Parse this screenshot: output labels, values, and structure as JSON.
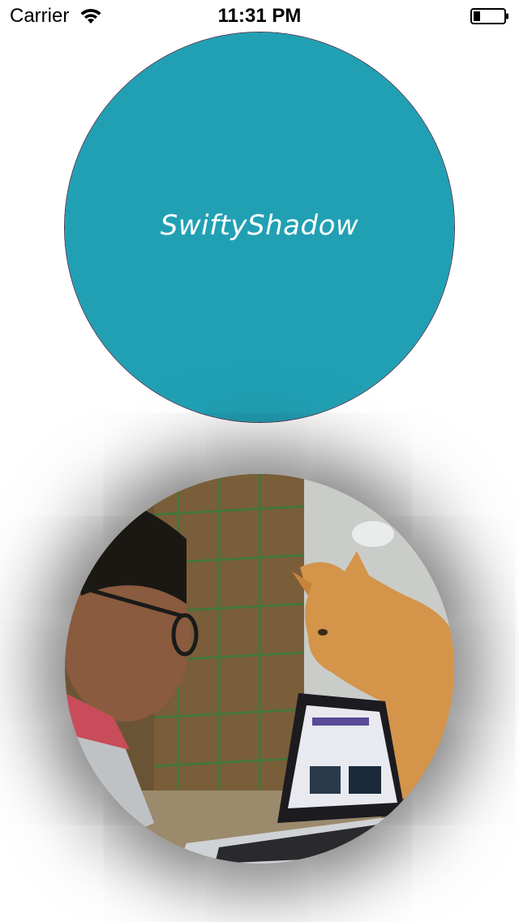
{
  "status_bar": {
    "carrier": "Carrier",
    "time": "11:31 PM",
    "wifi_icon": "wifi-icon",
    "battery_icon": "battery-icon"
  },
  "teal_view": {
    "label": "SwiftyShadow",
    "color": "#21a0b4",
    "shadow_color": "#4a3f58"
  },
  "photo_view": {
    "content": "photo-of-person-with-cat-at-laptop"
  }
}
